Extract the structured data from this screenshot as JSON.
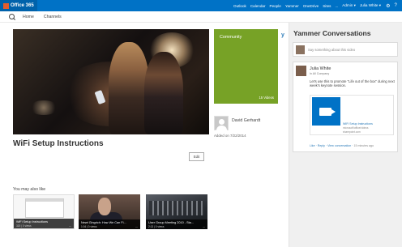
{
  "app": {
    "brand": "Office 365"
  },
  "topnav": {
    "items": [
      "Outlook",
      "Calendar",
      "People",
      "Yammer",
      "OneDrive",
      "Sites",
      "...",
      "Admin ▾"
    ],
    "user_name": "Julia White ▾",
    "gear": "⚙",
    "help": "?"
  },
  "subnav": {
    "home": "Home",
    "channels": "Channels"
  },
  "video": {
    "title": "WiFi Setup Instructions",
    "edit_label": "Edit",
    "community_label": "Community",
    "community_videos": "15 Videos",
    "author": "David Gerhardt",
    "added_on": "Added on 7/22/2014"
  },
  "related": {
    "heading": "You may also like",
    "items": [
      {
        "title": "WiFi Setup Instructions",
        "meta": "320 | 0 views",
        "more": "..."
      },
      {
        "title": "Newt Gingrich: How We Can Fi...",
        "meta": "1:04 | 0 views",
        "more": "..."
      },
      {
        "title": "User Group Meeting 2010 - Sta...",
        "meta": "2:13 | 0 views",
        "more": "..."
      }
    ]
  },
  "yammer": {
    "link": "y",
    "title": "Yammer Conversations",
    "compose_placeholder": "Say something about this video",
    "post": {
      "user": "Julia White",
      "group": "In All Company",
      "message": "Let's use this to promote \"Life out of the box\" during next week's keynote session.",
      "card_title": "WiFi Setup Instructions",
      "card_line1": "microsoft/office/videos",
      "card_line2": "sharepoint.com",
      "actions": "Like · Reply · View conversation · ",
      "time": "15 minutes ago"
    }
  },
  "colors": {
    "topbar": "#0072c6",
    "community": "#77a226",
    "link": "#2b7bb9"
  }
}
